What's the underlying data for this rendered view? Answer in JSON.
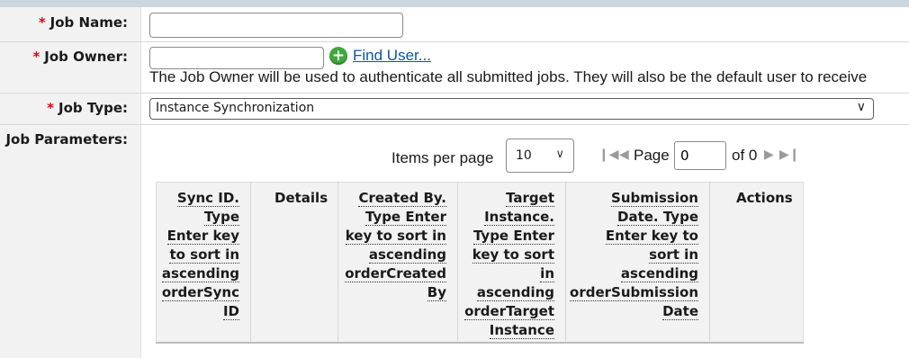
{
  "form": {
    "required_marker": "*",
    "job_name": {
      "label": "Job Name:",
      "value": ""
    },
    "job_owner": {
      "label": "Job Owner:",
      "value": "",
      "find_user_label": "Find User...",
      "description": "The Job Owner will be used to authenticate all submitted jobs. They will also be the default user to receive"
    },
    "job_type": {
      "label": "Job Type:",
      "selected": "Instance Synchronization"
    },
    "job_parameters": {
      "label": "Job Parameters:"
    }
  },
  "pagination": {
    "items_per_page_label": "Items per page",
    "items_per_page": "10",
    "page_label": "Page",
    "page_value": "0",
    "of_label": "of 0"
  },
  "table": {
    "columns": [
      {
        "label": "Sync ID. Type Enter key to sort in ascending orderSync ID",
        "lines": [
          "Sync ID.",
          "Type",
          "Enter key",
          "to sort in",
          "ascending",
          "orderSync",
          "ID"
        ]
      },
      {
        "label": "Details"
      },
      {
        "label": "Created By. Type Enter key to sort in ascending orderCreated By",
        "lines": [
          "Created By.",
          "Type Enter",
          "key to sort in",
          "ascending",
          "orderCreated",
          "By"
        ]
      },
      {
        "label": "Target Instance. Type Enter key to sort in ascending orderTarget Instance",
        "lines": [
          "Target",
          "Instance.",
          "Type Enter",
          "key to sort",
          "in",
          "ascending",
          "orderTarget",
          "Instance"
        ]
      },
      {
        "label": "Submission Date. Type Enter key to sort in ascending orderSubmission Date",
        "lines": [
          "Submission",
          "Date. Type",
          "Enter key to",
          "sort in",
          "ascending",
          "orderSubmission",
          "Date"
        ]
      },
      {
        "label": "Actions"
      }
    ]
  },
  "icons": {
    "add_user": "plus-circle-icon",
    "dropdown": "chevron-down-icon",
    "first_page": "first-page-icon",
    "prev_page": "previous-page-icon",
    "next_page": "next-page-icon",
    "last_page": "last-page-icon"
  },
  "colors": {
    "required": "#e0001a",
    "link": "#0b55a8",
    "add_icon": "#3ea83e",
    "label_bg": "#f2f2f2"
  }
}
